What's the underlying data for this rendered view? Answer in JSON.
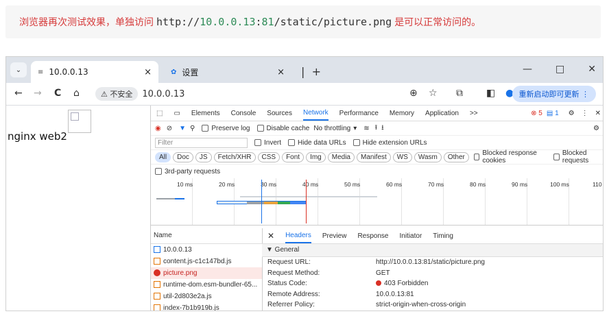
{
  "note": {
    "before": "浏览器再次测试效果，单独访问",
    "url_prefix": "http://",
    "url_ip": "10.0.0.13",
    "url_colon": ":",
    "url_port": "81",
    "url_path": "/static/picture.png",
    "after": "是可以正常访问的。"
  },
  "tabs": [
    {
      "title": "10.0.0.13",
      "close": "×"
    },
    {
      "title": "设置",
      "close": "×"
    }
  ],
  "window_controls": [
    "—",
    "□",
    "✕"
  ],
  "toolbar": {
    "back": "←",
    "forward": "→",
    "reload": "C",
    "home": "⌂",
    "security": "⚠ 不安全",
    "url": "10.0.0.13",
    "update_button": "重新启动即可更新 ⋮"
  },
  "page": {
    "text": "nginx web2"
  },
  "devtools": {
    "tabs": [
      "Elements",
      "Console",
      "Sources",
      "Network",
      "Performance",
      "Memory",
      "Application",
      ">>"
    ],
    "active_tab": "Network",
    "badges": {
      "errors": "5",
      "messages": "1"
    },
    "controls": {
      "preserve_log": "Preserve log",
      "disable_cache": "Disable cache",
      "throttling": "No throttling"
    },
    "filter": {
      "placeholder": "Filter",
      "invert": "Invert",
      "hide_data": "Hide data URLs",
      "hide_ext": "Hide extension URLs"
    },
    "types": [
      "All",
      "Doc",
      "JS",
      "Fetch/XHR",
      "CSS",
      "Font",
      "Img",
      "Media",
      "Manifest",
      "WS",
      "Wasm",
      "Other"
    ],
    "blocked_cookies": "Blocked response cookies",
    "blocked_requests": "Blocked requests",
    "third_party": "3rd-party requests",
    "ticks": [
      "10 ms",
      "20 ms",
      "30 ms",
      "40 ms",
      "50 ms",
      "60 ms",
      "70 ms",
      "80 ms",
      "90 ms",
      "100 ms",
      "110"
    ],
    "list_header": "Name",
    "requests": [
      "10.0.0.13",
      "content.js-c1c147bd.js",
      "picture.png",
      "runtime-dom.esm-bundler-65...",
      "util-2d803e2a.js",
      "index-7b1b919b.js"
    ],
    "detail_tabs": [
      "Headers",
      "Preview",
      "Response",
      "Initiator",
      "Timing"
    ],
    "general_label": "▼ General",
    "general": [
      {
        "k": "Request URL:",
        "v": "http://10.0.0.13:81/static/picture.png"
      },
      {
        "k": "Request Method:",
        "v": "GET"
      },
      {
        "k": "Status Code:",
        "v": "403 Forbidden"
      },
      {
        "k": "Remote Address:",
        "v": "10.0.0.13:81"
      },
      {
        "k": "Referrer Policy:",
        "v": "strict-origin-when-cross-origin"
      }
    ]
  }
}
